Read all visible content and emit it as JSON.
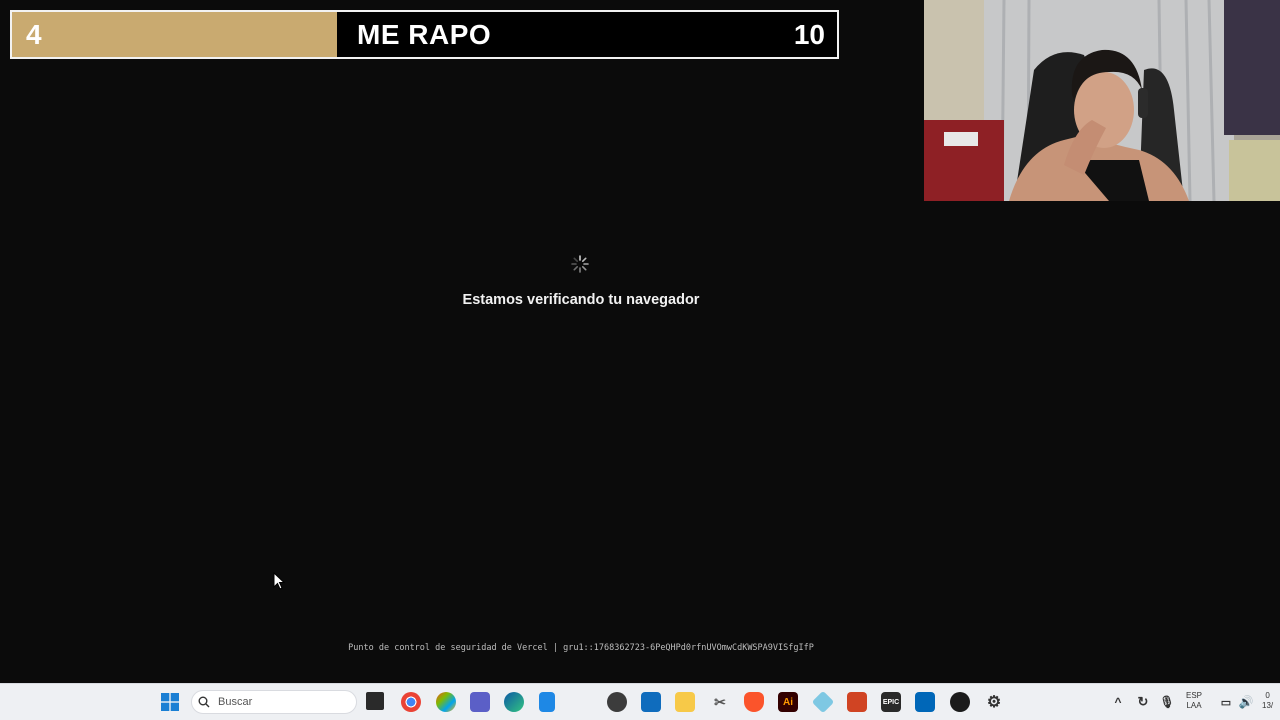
{
  "overlay": {
    "left_score": "4",
    "title": "ME RAPO",
    "right_score": "10",
    "left_color": "#c9aa70"
  },
  "verification": {
    "message": "Estamos verificando tu navegador",
    "footer": "Punto de control de seguridad de Vercel | gru1::1768362723-6PeQHPd0rfnUVOmwCdKWSPA9VISfgIfP"
  },
  "taskbar": {
    "search_placeholder": "Buscar",
    "language_top": "ESP",
    "language_bottom": "LAA",
    "clock_top": "0",
    "clock_bottom": "13/"
  }
}
